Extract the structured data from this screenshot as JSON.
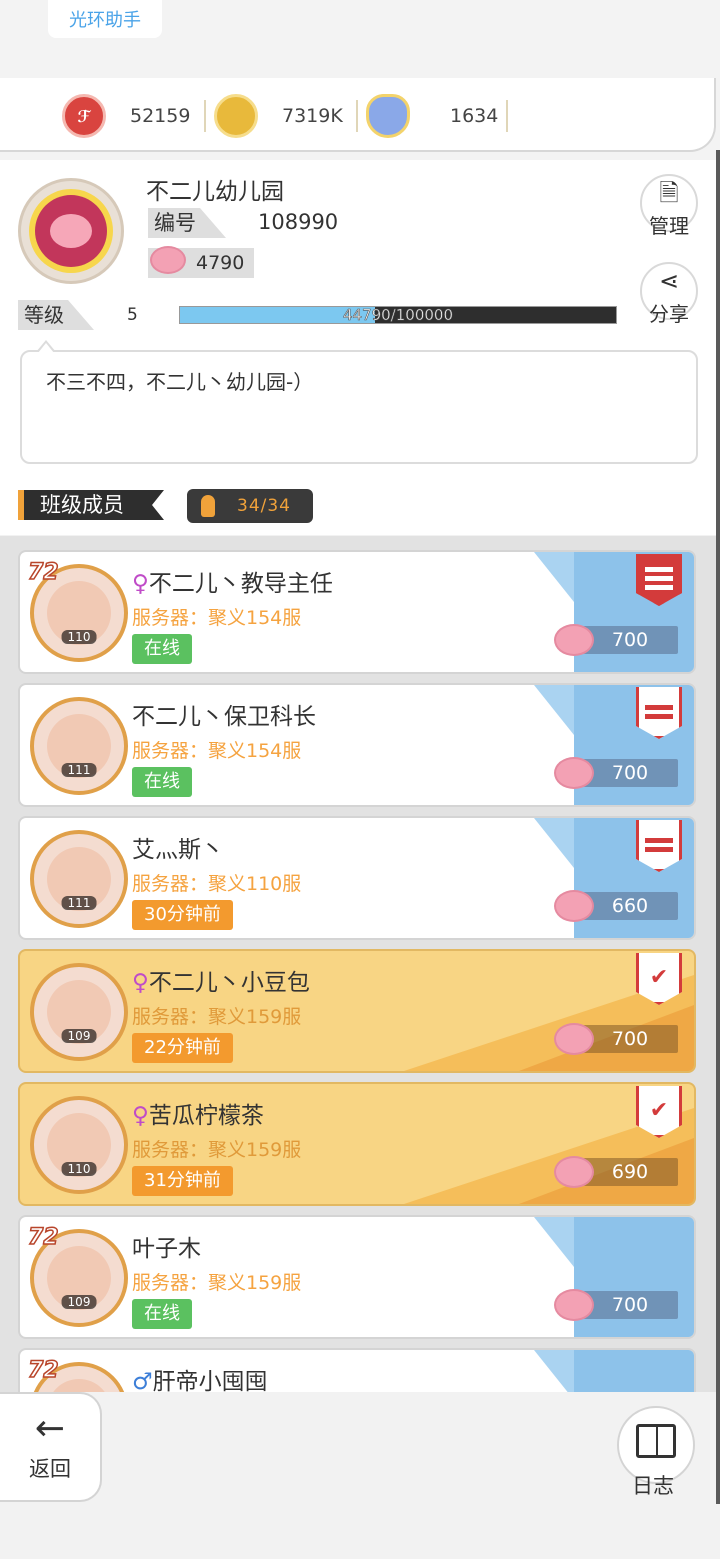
{
  "header": {
    "helper": "光环助手",
    "resources": [
      {
        "icon": "red-gem-icon",
        "value": "52159"
      },
      {
        "icon": "gold-coin-icon",
        "value": "7319K"
      },
      {
        "icon": "crystal-ring-icon",
        "value": "1634"
      }
    ]
  },
  "club": {
    "name": "不二儿幼儿园",
    "id_label": "编号",
    "id_value": "108990",
    "pig_value": "4790",
    "level_label": "等级",
    "level_value": "5",
    "progress_text": "44790/100000",
    "progress_fraction": 0.4479,
    "manage_label": "管理",
    "share_label": "分享",
    "motto": "不三不四，不二儿丶幼儿园-）",
    "members_label": "班级成员",
    "members_count": "34/34"
  },
  "members": [
    {
      "gender": "♀",
      "name": "不二儿丶教导主任",
      "server": "服务器：聚义154服",
      "status": "在线",
      "status_type": "online",
      "level": "110",
      "frame": "72",
      "contribution": "700",
      "rank": "chief",
      "gold": false
    },
    {
      "gender": "",
      "name": "不二儿丶保卫科长",
      "server": "服务器：聚义154服",
      "status": "在线",
      "status_type": "online",
      "level": "111",
      "frame": "",
      "contribution": "700",
      "rank": "officer",
      "gold": false
    },
    {
      "gender": "",
      "name": "艾灬斯丶",
      "server": "服务器：聚义110服",
      "status": "30分钟前",
      "status_type": "away",
      "level": "111",
      "frame": "",
      "contribution": "660",
      "rank": "officer",
      "gold": false
    },
    {
      "gender": "♀",
      "name": "不二儿丶小豆包",
      "server": "服务器：聚义159服",
      "status": "22分钟前",
      "status_type": "away",
      "level": "109",
      "frame": "",
      "contribution": "700",
      "rank": "vee",
      "gold": true
    },
    {
      "gender": "♀",
      "name": "苦瓜柠檬茶",
      "server": "服务器：聚义159服",
      "status": "31分钟前",
      "status_type": "away",
      "level": "110",
      "frame": "",
      "contribution": "690",
      "rank": "vee",
      "gold": true
    },
    {
      "gender": "",
      "name": "叶子木",
      "server": "服务器：聚义159服",
      "status": "在线",
      "status_type": "online",
      "level": "109",
      "frame": "72",
      "contribution": "700",
      "rank": "",
      "gold": false
    },
    {
      "gender": "♂",
      "name": "肝帝小囤囤",
      "server": "",
      "status": "",
      "status_type": "",
      "level": "",
      "frame": "72",
      "contribution": "",
      "rank": "",
      "gold": false
    }
  ],
  "bottom": {
    "back_label": "返回",
    "log_label": "日志"
  },
  "colors": {
    "online": "#5bc160",
    "away": "#f39a2e",
    "accent_blue": "#7cc8f0",
    "rank_red": "#d33b3b"
  }
}
